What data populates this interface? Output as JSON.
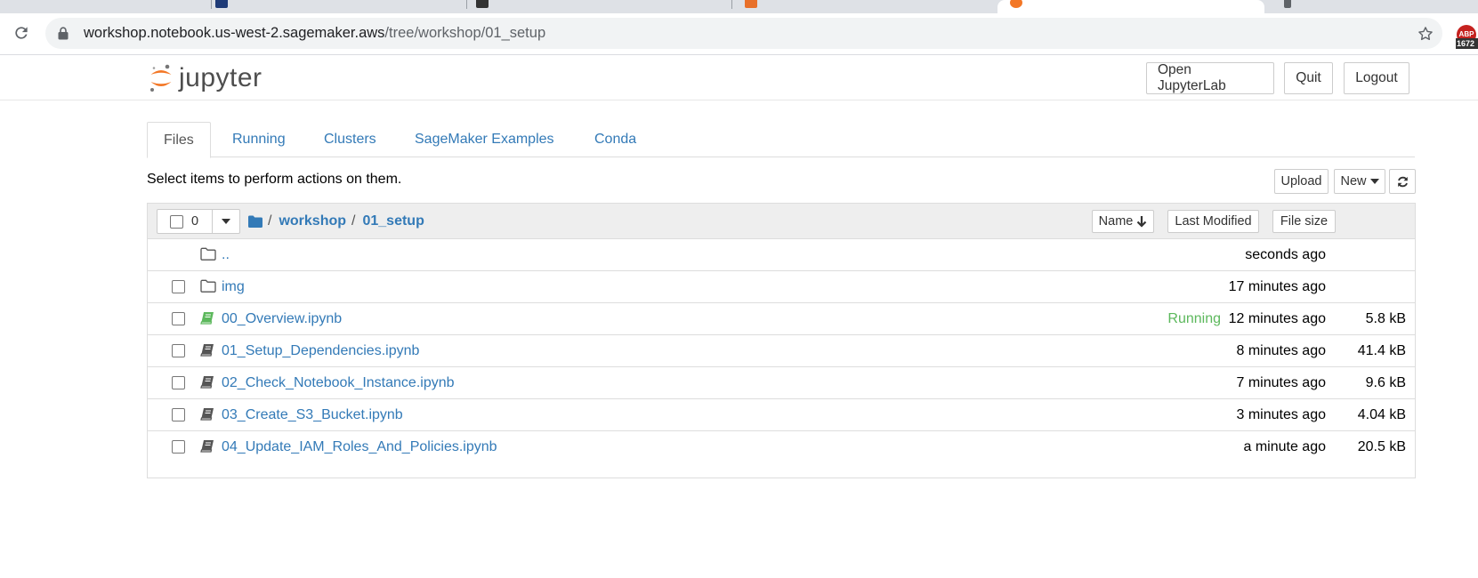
{
  "browser": {
    "url_host": "workshop.notebook.us-west-2.sagemaker.aws",
    "url_path": "/tree/workshop/01_setup",
    "extension_badge_top": "ABP",
    "extension_badge_count": "1672"
  },
  "header": {
    "logo_text": "jupyter",
    "open_lab_label": "Open JupyterLab",
    "quit_label": "Quit",
    "logout_label": "Logout"
  },
  "tabs": [
    {
      "label": "Files"
    },
    {
      "label": "Running"
    },
    {
      "label": "Clusters"
    },
    {
      "label": "SageMaker Examples"
    },
    {
      "label": "Conda"
    }
  ],
  "toolbar": {
    "hint": "Select items to perform actions on them.",
    "upload_label": "Upload",
    "new_label": "New"
  },
  "list": {
    "selected_count": "0",
    "breadcrumb": [
      "workshop",
      "01_setup"
    ],
    "sort_name_label": "Name",
    "sort_modified_label": "Last Modified",
    "sort_size_label": "File size",
    "rows": [
      {
        "name": "..",
        "type": "up",
        "status": "",
        "modified": "seconds ago",
        "size": ""
      },
      {
        "name": "img",
        "type": "folder",
        "status": "",
        "modified": "17 minutes ago",
        "size": ""
      },
      {
        "name": "00_Overview.ipynb",
        "type": "notebook-running",
        "status": "Running",
        "modified": "12 minutes ago",
        "size": "5.8 kB"
      },
      {
        "name": "01_Setup_Dependencies.ipynb",
        "type": "notebook",
        "status": "",
        "modified": "8 minutes ago",
        "size": "41.4 kB"
      },
      {
        "name": "02_Check_Notebook_Instance.ipynb",
        "type": "notebook",
        "status": "",
        "modified": "7 minutes ago",
        "size": "9.6 kB"
      },
      {
        "name": "03_Create_S3_Bucket.ipynb",
        "type": "notebook",
        "status": "",
        "modified": "3 minutes ago",
        "size": "4.04 kB"
      },
      {
        "name": "04_Update_IAM_Roles_And_Policies.ipynb",
        "type": "notebook",
        "status": "",
        "modified": "a minute ago",
        "size": "20.5 kB"
      }
    ]
  },
  "colors": {
    "link": "#337ab7",
    "running": "#5cb85c",
    "logo_orange": "#f37726"
  }
}
